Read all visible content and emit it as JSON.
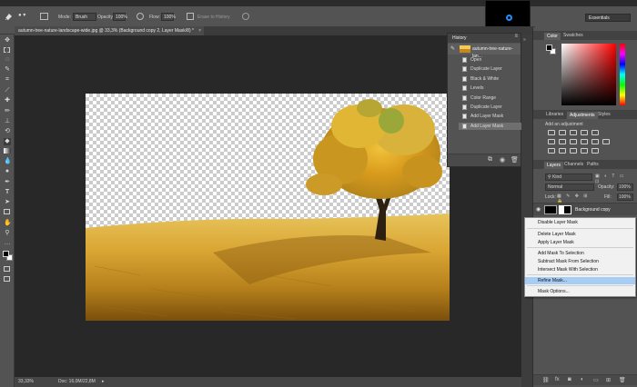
{
  "options_bar": {
    "mode_label": "Mode:",
    "mode_value": "Brush",
    "opacity_label": "Opacity:",
    "opacity_value": "100%",
    "flow_label": "Flow:",
    "flow_value": "100%",
    "erase_history": "Erase to History",
    "workspace": "Essentials"
  },
  "document": {
    "tab_title": "autumn-tree-nature-landscape-wide.jpg @ 33,3% (Background copy 2, Layer Mask/8) *"
  },
  "status": {
    "zoom": "33,33%",
    "doc": "Doc: 16,0M/22,8M"
  },
  "history": {
    "title": "History",
    "snapshot": "autumn-tree-nature-lan...",
    "items": [
      {
        "label": "Open",
        "active": false
      },
      {
        "label": "Duplicate Layer",
        "active": false
      },
      {
        "label": "Black & White",
        "active": false
      },
      {
        "label": "Levels",
        "active": false
      },
      {
        "label": "Color Range",
        "active": false
      },
      {
        "label": "Duplicate Layer",
        "active": false
      },
      {
        "label": "Add Layer Mask",
        "active": false
      },
      {
        "label": "Add Layer Mask",
        "active": true
      }
    ]
  },
  "color_panel": {
    "tabs": [
      "Color",
      "Swatches"
    ],
    "foreground": "#000000",
    "background": "#ffffff"
  },
  "adjustments_panel": {
    "tabs": [
      "Libraries",
      "Adjustments",
      "Styles"
    ],
    "hint": "Add an adjustment"
  },
  "layers_panel": {
    "tabs": [
      "Layers",
      "Channels",
      "Paths"
    ],
    "filter": "Kind",
    "blend": "Normal",
    "opacity_label": "Opacity:",
    "opacity_value": "100%",
    "lock_label": "Lock:",
    "fill_label": "Fill:",
    "fill_value": "100%",
    "layer_name": "Background copy"
  },
  "context_menu": {
    "items": [
      {
        "label": "Disable Layer Mask",
        "highlighted": false
      },
      {
        "label": "Delete Layer Mask",
        "highlighted": false
      },
      {
        "label": "Apply Layer Mask",
        "highlighted": false
      },
      {
        "label": "Add Mask To Selection",
        "highlighted": false
      },
      {
        "label": "Subtract Mask From Selection",
        "highlighted": false
      },
      {
        "label": "Intersect Mask With Selection",
        "highlighted": false
      },
      {
        "label": "Refine Mask...",
        "highlighted": true
      },
      {
        "label": "Mask Options...",
        "highlighted": false
      }
    ]
  },
  "icons": [
    "eraser-icon",
    "move-icon",
    "marquee-icon",
    "lasso-icon",
    "crop-icon",
    "brush-icon",
    "hand-icon",
    "zoom-icon",
    "camera-icon",
    "trash-icon",
    "new-layer-icon",
    "folder-icon",
    "fx-icon",
    "link-icon",
    "eye-icon"
  ]
}
